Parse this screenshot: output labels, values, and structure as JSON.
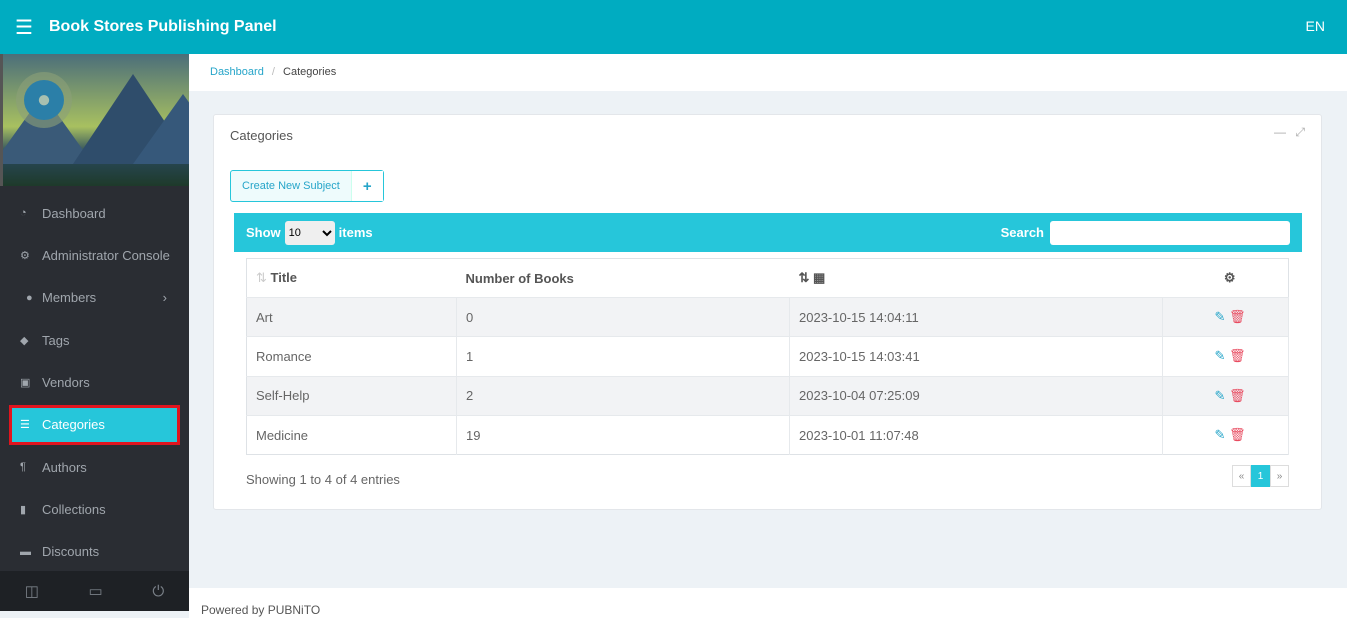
{
  "header": {
    "title": "Book Stores Publishing Panel",
    "language": "EN"
  },
  "sidebar": {
    "items": [
      {
        "label": "Dashboard",
        "icon": "gauge-icon"
      },
      {
        "label": "Administrator Console",
        "icon": "cogs-icon"
      },
      {
        "label": "Members",
        "icon": "user-icon"
      },
      {
        "label": "Tags",
        "icon": "tag-icon"
      },
      {
        "label": "Vendors",
        "icon": "id-card-icon"
      },
      {
        "label": "Categories",
        "icon": "list-icon",
        "active": true
      },
      {
        "label": "Authors",
        "icon": "paragraph-icon"
      },
      {
        "label": "Collections",
        "icon": "book-icon"
      },
      {
        "label": "Discounts",
        "icon": "money-icon"
      }
    ]
  },
  "breadcrumb": {
    "home": "Dashboard",
    "current": "Categories"
  },
  "card": {
    "title": "Categories",
    "create_label": "Create New Subject"
  },
  "table_controls": {
    "show": "Show",
    "page_size": "10",
    "items": "items",
    "search": "Search"
  },
  "table": {
    "columns": [
      "Title",
      "Number of Books"
    ],
    "rows": [
      {
        "title": "Art",
        "books": "0",
        "date": "2023-10-15 14:04:11"
      },
      {
        "title": "Romance",
        "books": "1",
        "date": "2023-10-15 14:03:41"
      },
      {
        "title": "Self-Help",
        "books": "2",
        "date": "2023-10-04 07:25:09"
      },
      {
        "title": "Medicine",
        "books": "19",
        "date": "2023-10-01 11:07:48"
      }
    ]
  },
  "pagination": {
    "info": "Showing 1 to 4 of 4 entries",
    "prev": "«",
    "current": "1",
    "next": "»"
  },
  "footer": {
    "text": "Powered by PUBNiTO"
  }
}
